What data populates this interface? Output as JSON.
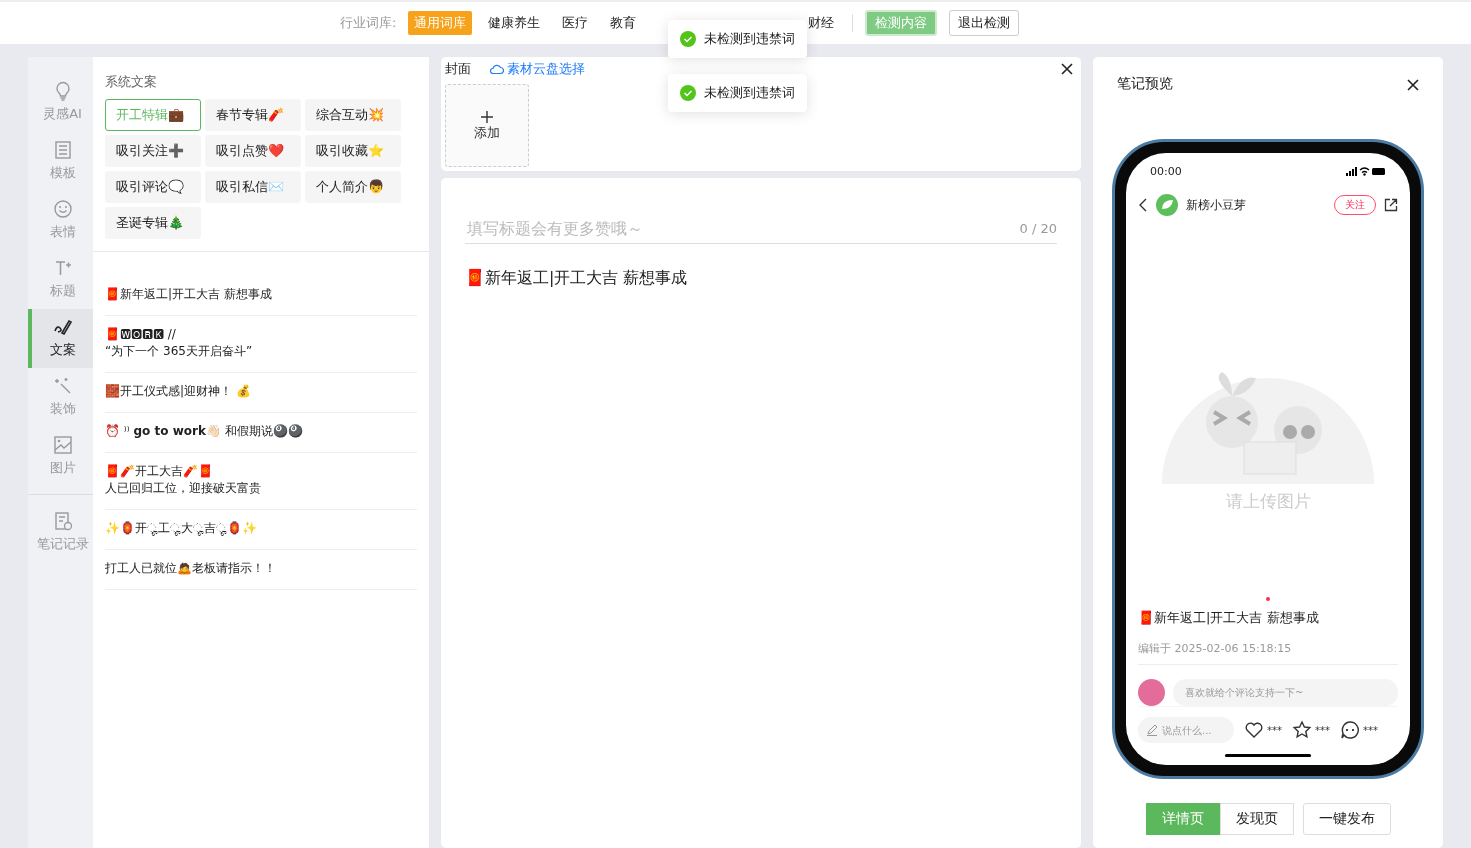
{
  "top_bar": {
    "label": "行业词库:",
    "categories": [
      {
        "label": "通用词库",
        "selected": true
      },
      {
        "label": "健康养生",
        "selected": false
      },
      {
        "label": "医疗",
        "selected": false
      },
      {
        "label": "教育",
        "selected": false
      },
      {
        "label": "财经",
        "selected": false
      }
    ],
    "check_button": "检测内容",
    "exit_button": "退出检测"
  },
  "toasts": [
    "未检测到违禁词",
    "未检测到违禁词"
  ],
  "rail": [
    {
      "label": "灵感AI",
      "selected": false
    },
    {
      "label": "模板",
      "selected": false
    },
    {
      "label": "表情",
      "selected": false
    },
    {
      "label": "标题",
      "selected": false
    },
    {
      "label": "文案",
      "selected": true
    },
    {
      "label": "装饰",
      "selected": false
    },
    {
      "label": "图片",
      "selected": false
    },
    {
      "label": "笔记记录",
      "selected": false
    }
  ],
  "copy_panel": {
    "title": "系统文案",
    "chips": [
      {
        "label": "开工特辑💼",
        "selected": true
      },
      {
        "label": "春节专辑🧨",
        "selected": false
      },
      {
        "label": "综合互动💥",
        "selected": false
      },
      {
        "label": "吸引关注➕",
        "selected": false
      },
      {
        "label": "吸引点赞❤️",
        "selected": false
      },
      {
        "label": "吸引收藏⭐",
        "selected": false
      },
      {
        "label": "吸引评论🗨️",
        "selected": false
      },
      {
        "label": "吸引私信✉️",
        "selected": false
      },
      {
        "label": "个人简介👦",
        "selected": false
      },
      {
        "label": "圣诞专辑🎄",
        "selected": false
      }
    ],
    "items": [
      {
        "lines": [
          "🧧新年返工|开工大吉 薪想事成"
        ]
      },
      {
        "lines": [
          "🧧🆆🅾🆁🅺 //",
          "“为下一个 365天开启奋斗”"
        ]
      },
      {
        "lines": [
          "🧱开工仪式感|迎财神！ 💰"
        ]
      },
      {
        "lines": [
          "⏰ ⁾⁾ **go to work**👋🏻 和假期说🎱🎱"
        ]
      },
      {
        "lines": [
          "🧧🧨开工大吉🧨🧧",
          "人已回归工位，迎接破天富贵"
        ]
      },
      {
        "lines": [
          "✨🏮开ೄ工ೄ大ೄ吉ೄ🏮✨"
        ]
      },
      {
        "lines": [
          "打工人已就位🙇老板请指示！！"
        ]
      }
    ]
  },
  "cover": {
    "label": "封面",
    "cloud_link": "素材云盘选择",
    "add_label": "添加"
  },
  "editor": {
    "title_placeholder": "填写标题会有更多赞哦～",
    "counter": "0 / 20",
    "body": "🧧新年返工|开工大吉 薪想事成"
  },
  "preview": {
    "title": "笔记预览",
    "time": "00:00",
    "author": "新榜小豆芽",
    "follow": "关注",
    "image_hint": "请上传图片",
    "note_title": "🧧新年返工|开工大吉 薪想事成",
    "edited": "编辑于 2025-02-06 15:18:15",
    "comment_placeholder": "喜欢就给个评论支持一下~",
    "say_placeholder": "说点什么...",
    "counts": [
      "***",
      "***",
      "***"
    ],
    "tabs": [
      {
        "label": "详情页",
        "selected": true
      },
      {
        "label": "发现页",
        "selected": false
      }
    ],
    "publish": "一键发布"
  }
}
